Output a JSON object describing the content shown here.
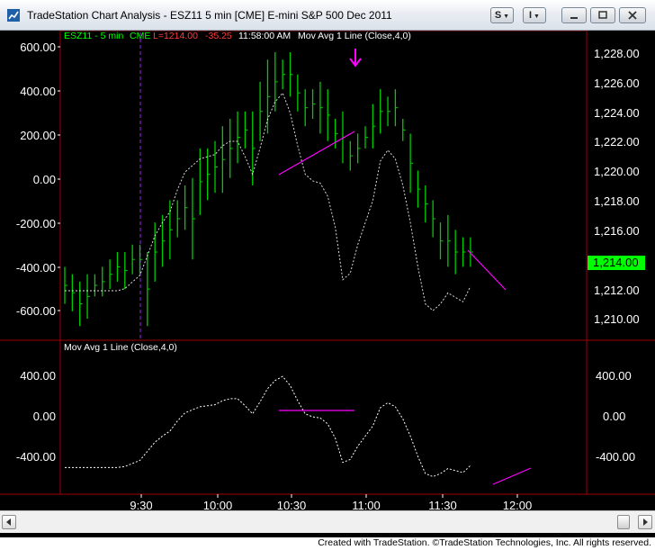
{
  "window": {
    "title": "TradeStation Chart Analysis - ESZ11 5 min [CME] E-mini S&P 500 Dec 2011",
    "buttons": {
      "s_label": "S",
      "i_label": "I"
    }
  },
  "price_pane": {
    "symbol": "ESZ11 - 5 min",
    "exchange": "CME",
    "last": "L=1214.00",
    "change": "-35.25",
    "time": "11:58:00 AM",
    "indicator": "Mov Avg 1 Line (Close,4,0)",
    "current_price_tag": "1,214.00",
    "left_ticks": [
      "600.00",
      "400.00",
      "200.00",
      "0.00",
      "-200.00",
      "-400.00",
      "-600.00"
    ],
    "right_ticks": [
      "1,228.00",
      "1,226.00",
      "1,224.00",
      "1,222.00",
      "1,220.00",
      "1,218.00",
      "1,216.00",
      "1,212.00",
      "1,210.00"
    ]
  },
  "indicator_pane": {
    "label": "Mov Avg 1 Line (Close,4,0)",
    "left_ticks": [
      "400.00",
      "0.00",
      "-400.00"
    ],
    "right_ticks": [
      "400.00",
      "0.00",
      "-400.00"
    ]
  },
  "time_axis": {
    "labels": [
      "9:30",
      "10:00",
      "10:30",
      "11:00",
      "11:30",
      "12:00"
    ]
  },
  "footer": {
    "credit": "Created with TradeStation. ©TradeStation Technologies, Inc. All rights reserved."
  },
  "colors": {
    "background": "#000000",
    "bars": "#00cc00",
    "ma_line": "#ffffff",
    "pane_border": "#cc0000",
    "trend_lines": "#ff00ff",
    "symbol_text": "#00ff00",
    "change_text": "#ff3b3b",
    "price_tag": "#00ff00"
  },
  "chart_data": {
    "type": "bar",
    "title": "ESZ11 5 min [CME] E-mini S&P 500 Dec 2011",
    "x_labels": [
      "9:30",
      "10:00",
      "10:30",
      "11:00",
      "11:30",
      "12:00"
    ],
    "price_ylim": [
      1209,
      1229
    ],
    "bars_high_low": [
      [
        1213.5,
        1211.0
      ],
      [
        1213.0,
        1210.5
      ],
      [
        1212.5,
        1209.5
      ],
      [
        1213.0,
        1210.0
      ],
      [
        1213.0,
        1211.5
      ],
      [
        1213.5,
        1211.5
      ],
      [
        1214.0,
        1212.0
      ],
      [
        1214.5,
        1212.5
      ],
      [
        1214.5,
        1212.0
      ],
      [
        1215.0,
        1213.0
      ],
      [
        1215.0,
        1213.0
      ],
      [
        1214.5,
        1209.5
      ],
      [
        1216.5,
        1212.5
      ],
      [
        1217.0,
        1213.5
      ],
      [
        1218.0,
        1214.0
      ],
      [
        1218.0,
        1215.5
      ],
      [
        1219.0,
        1216.0
      ],
      [
        1219.5,
        1214.0
      ],
      [
        1221.5,
        1217.0
      ],
      [
        1221.5,
        1218.0
      ],
      [
        1222.0,
        1218.5
      ],
      [
        1223.0,
        1218.5
      ],
      [
        1223.5,
        1219.5
      ],
      [
        1224.0,
        1220.5
      ],
      [
        1224.0,
        1221.5
      ],
      [
        1224.0,
        1219.0
      ],
      [
        1226.0,
        1222.0
      ],
      [
        1227.5,
        1222.5
      ],
      [
        1228.0,
        1224.0
      ],
      [
        1227.5,
        1225.5
      ],
      [
        1228.0,
        1225.0
      ],
      [
        1226.5,
        1224.0
      ],
      [
        1225.5,
        1223.0
      ],
      [
        1225.5,
        1223.5
      ],
      [
        1226.0,
        1222.5
      ],
      [
        1225.5,
        1222.0
      ],
      [
        1223.5,
        1221.5
      ],
      [
        1224.0,
        1220.5
      ],
      [
        1222.0,
        1220.0
      ],
      [
        1222.5,
        1220.5
      ],
      [
        1223.0,
        1221.5
      ],
      [
        1224.5,
        1221.5
      ],
      [
        1225.5,
        1222.5
      ],
      [
        1225.0,
        1223.0
      ],
      [
        1225.5,
        1223.0
      ],
      [
        1223.5,
        1222.0
      ],
      [
        1222.5,
        1218.5
      ],
      [
        1220.0,
        1217.5
      ],
      [
        1219.0,
        1216.5
      ],
      [
        1218.0,
        1215.5
      ],
      [
        1216.5,
        1214.0
      ],
      [
        1217.0,
        1213.5
      ],
      [
        1216.0,
        1213.0
      ],
      [
        1215.5,
        1213.5
      ],
      [
        1215.5,
        1213.5
      ]
    ],
    "moving_average_1line": [
      -510,
      -510,
      -510,
      -510,
      -510,
      -510,
      -510,
      -510,
      -500,
      -470,
      -440,
      -350,
      -260,
      -200,
      -150,
      -50,
      30,
      60,
      90,
      100,
      110,
      150,
      170,
      170,
      100,
      20,
      140,
      270,
      350,
      390,
      300,
      150,
      20,
      -10,
      -20,
      -80,
      -220,
      -460,
      -430,
      -300,
      -200,
      -100,
      80,
      130,
      90,
      -30,
      -200,
      -400,
      -570,
      -600,
      -570,
      -520,
      -540,
      -560,
      -490
    ],
    "ma_ylim": [
      -700,
      700
    ]
  }
}
